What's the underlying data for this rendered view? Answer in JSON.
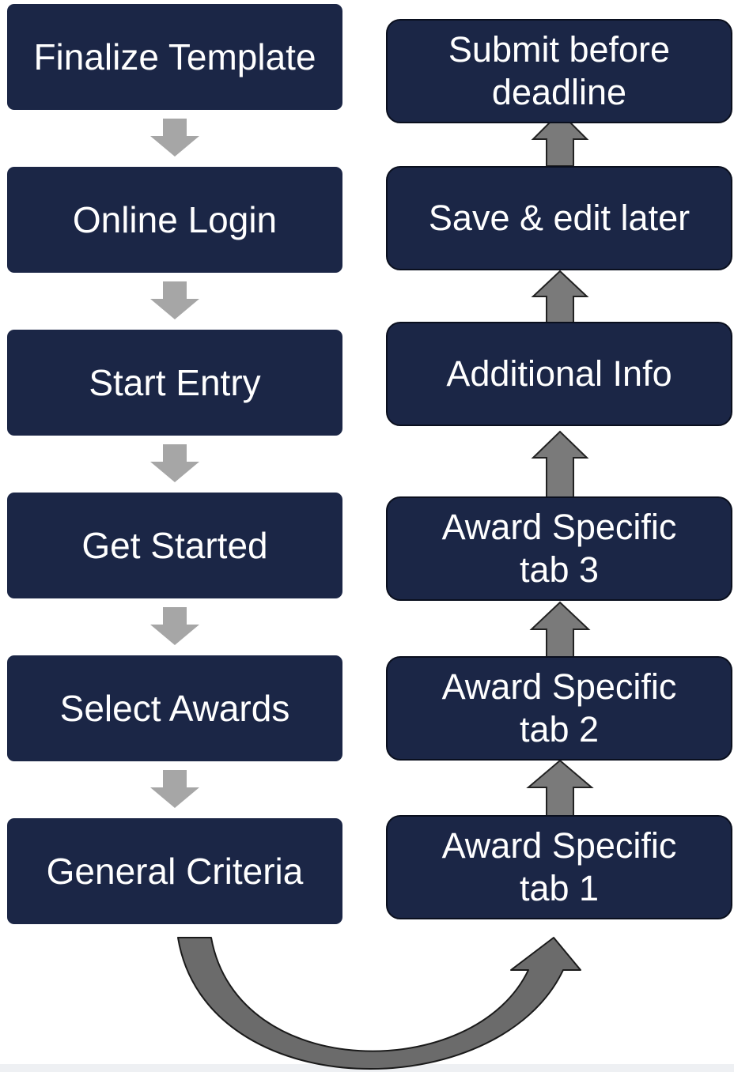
{
  "left_steps": [
    {
      "label": "Finalize Template"
    },
    {
      "label": "Online Login"
    },
    {
      "label": "Start Entry"
    },
    {
      "label": "Get Started"
    },
    {
      "label": "Select Awards"
    },
    {
      "label": "General Criteria"
    }
  ],
  "right_steps": [
    {
      "label": "Submit before deadline"
    },
    {
      "label": "Save & edit later"
    },
    {
      "label": "Additional Info"
    },
    {
      "label": "Award Specific tab 3"
    },
    {
      "label": "Award Specific tab 2"
    },
    {
      "label": "Award Specific tab 1"
    }
  ],
  "colors": {
    "box_fill": "#1b2646",
    "box_text": "#ffffff",
    "down_arrow": "#a6a6a6",
    "up_arrow": "#7a7a7a",
    "curved_arrow": "#6b6b6b"
  }
}
